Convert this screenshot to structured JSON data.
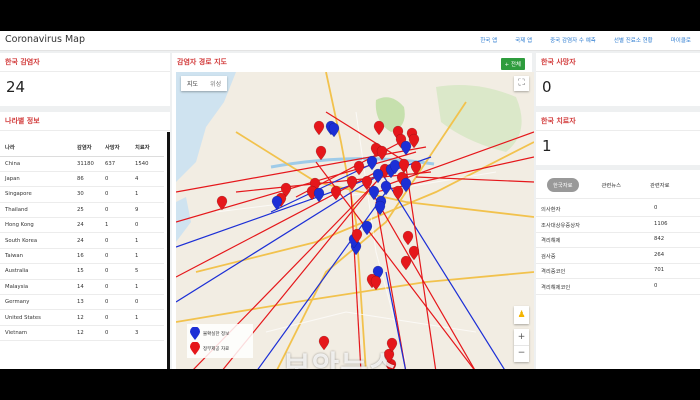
{
  "app": {
    "title": "Coronavirus Map",
    "nav": [
      "한국 앱",
      "국제 앱",
      "중국 감염자 수 예측",
      "선별 진료소 현황",
      "마이클로"
    ]
  },
  "korea_cases": {
    "title": "한국 감염자",
    "value": "24"
  },
  "country_info": {
    "title": "나라별 정보",
    "columns": [
      "나라",
      "감염자",
      "사망자",
      "치료자"
    ],
    "rows": [
      [
        "China",
        "31180",
        "637",
        "1540"
      ],
      [
        "Japan",
        "86",
        "0",
        "4"
      ],
      [
        "Singapore",
        "30",
        "0",
        "1"
      ],
      [
        "Thailand",
        "25",
        "0",
        "9"
      ],
      [
        "Hong Kong",
        "24",
        "1",
        "0"
      ],
      [
        "South Korea",
        "24",
        "0",
        "1"
      ],
      [
        "Taiwan",
        "16",
        "0",
        "1"
      ],
      [
        "Australia",
        "15",
        "0",
        "5"
      ],
      [
        "Malaysia",
        "14",
        "0",
        "1"
      ],
      [
        "Germany",
        "13",
        "0",
        "0"
      ],
      [
        "United States",
        "12",
        "0",
        "1"
      ],
      [
        "Vietnam",
        "12",
        "0",
        "3"
      ]
    ]
  },
  "route_map": {
    "title": "감염자 경로 지도",
    "all_button": "전체",
    "map_types": [
      "지도",
      "위성"
    ],
    "legend": [
      "불확실한 정보",
      "정부제공 자료"
    ],
    "watermark": "보안뉴스",
    "colors": {
      "blue": "#1c2fd6",
      "red": "#e5171b"
    }
  },
  "korea_deaths": {
    "title": "한국 사망자",
    "value": "0"
  },
  "korea_recovered": {
    "title": "한국 치료자",
    "value": "1"
  },
  "stats": {
    "tabs": [
      "한국자료",
      "관련뉴스",
      "관련자료"
    ],
    "rows": [
      [
        "의사환자",
        "0"
      ],
      [
        "조사대상유증상자",
        "1106"
      ],
      [
        "격리해제",
        "842"
      ],
      [
        "검사중",
        "264"
      ],
      [
        "격리중코인",
        "701"
      ],
      [
        "격리해제코인",
        "0"
      ]
    ]
  }
}
